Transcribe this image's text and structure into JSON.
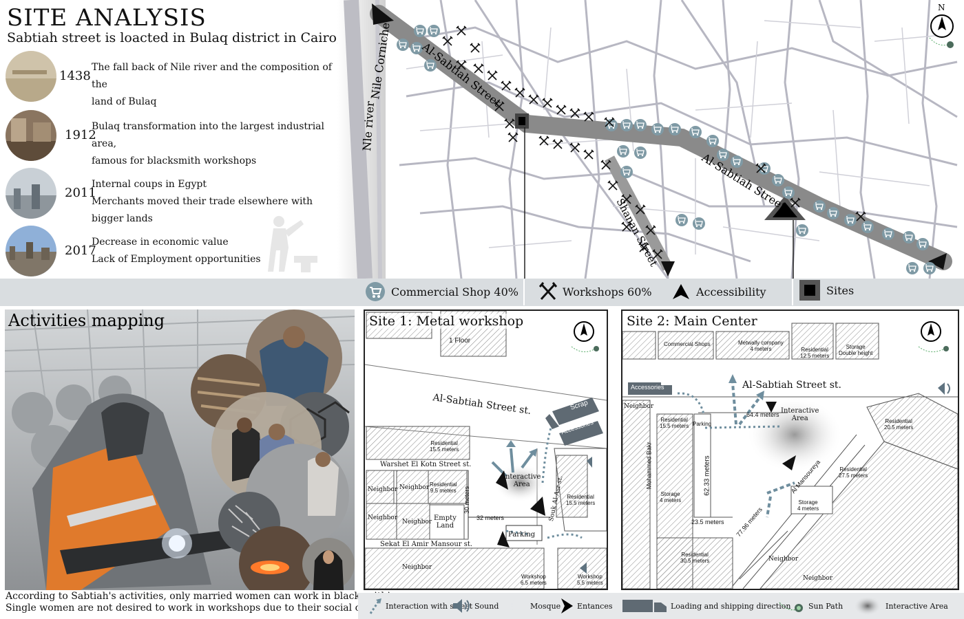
{
  "header": {
    "title": "SITE ANALYSIS",
    "subtitle": "Sabtiah street is loacted in Bulaq district in Cairo, Egypt"
  },
  "timeline": [
    {
      "year": "1438",
      "line1": "The fall back of Nile river and the composition of the",
      "line2": "land of Bulaq"
    },
    {
      "year": "1912",
      "line1": "Bulaq transformation into the largest industrial area,",
      "line2": "famous for blacksmith workshops"
    },
    {
      "year": "2011",
      "line1": "Internal coups in Egypt",
      "line2": "Merchants moved their trade elsewhere with bigger lands"
    },
    {
      "year": "2017",
      "line1": "Decrease in economic value",
      "line2": "Lack of Employment opportunities"
    }
  ],
  "map": {
    "nile_corniche": "Nile Corniche",
    "nile_river": "Nle river",
    "street1": "Al-Sabtiah Street",
    "street2": "Al-Sabtiah Street",
    "street3": "Shanan Street",
    "north": "N"
  },
  "legend": {
    "commercial": "Commercial Shop 40%",
    "workshops": "Workshops 60%",
    "accessibility": "Accessibility",
    "sites": "Sites"
  },
  "activities": {
    "title": "Activities mapping",
    "note1": "According to Sabtiah's activities, only married women can work in blacksmithing",
    "note2": "Single women are not desired to work in workshops due to their social culture."
  },
  "site1": {
    "title": "Site 1: Metal workshop",
    "floor": "1 Floor",
    "street": "Al-Sabtiah Street st.",
    "scrap": "Scrap",
    "accessories": "Accessories",
    "residential1": "Residential",
    "residential1_h": "15.5 meters",
    "warshet": "Warshet El Kotn Street st.",
    "neighbor": "Neighbor",
    "residential2": "Residential",
    "residential2_h": "9.5 meters",
    "interactive": "Interactive",
    "area": "Area",
    "souk": "Souk Al-Asr st.",
    "residential3": "Residential",
    "residential3_h": "15.5 meters",
    "m30": "30 meters",
    "m32": "32 meters",
    "empty": "Empty",
    "land": "Land",
    "parking": "Parking",
    "sekat": "Sekat El Amir Mansour st.",
    "workshop": "Workshop",
    "workshop_h1": "6.5 meters",
    "workshop_h2": "5.5 meters"
  },
  "site2": {
    "title": "Site 2: Main Center",
    "commercial": "Commercial Shops",
    "metwally": "Metwally company",
    "metwally_h": "4 meters",
    "residential_a": "Residential",
    "residential_a_h": "12.5 meters",
    "storage": "Storage",
    "storage_h": "Double height",
    "accessories": "Accessories",
    "street": "Al-Sabtiah Street st.",
    "neighbor": "Neighbor",
    "residential_b": "Residential",
    "residential_b_h": "15.5 meters",
    "parking": "Parking",
    "m644": "64.4 meters",
    "interactive": "Interactive",
    "area": "Area",
    "residential_c": "Residential",
    "residential_c_h": "20.5 meters",
    "mohammed": "Mohammed Bakr",
    "m6233": "62.33 meters",
    "mansoureya": "Al Mansoureya",
    "residential_d": "Residential",
    "residential_d_h": "27.5 meters",
    "storage2": "Storage",
    "storage2_h": "4 meters",
    "storage3": "Storage",
    "storage3_h": "4 meters",
    "m7796": "77.96 meters",
    "m235": "23.5 meters",
    "residential_e": "Residential",
    "residential_e_h": "30.5 meters"
  },
  "bottom_legend": {
    "interaction": "Interaction with street",
    "sound": "Sound",
    "mosque": "Mosque",
    "entrances": "Entances",
    "loading": "Loading and shipping direction",
    "sun": "Sun Path",
    "interactive": "Interactive Area"
  },
  "colors": {
    "road": "#888888",
    "shop": "#7f9aa5",
    "arrow": "#6f8e9e",
    "legend_bg": "#d9dde0"
  }
}
